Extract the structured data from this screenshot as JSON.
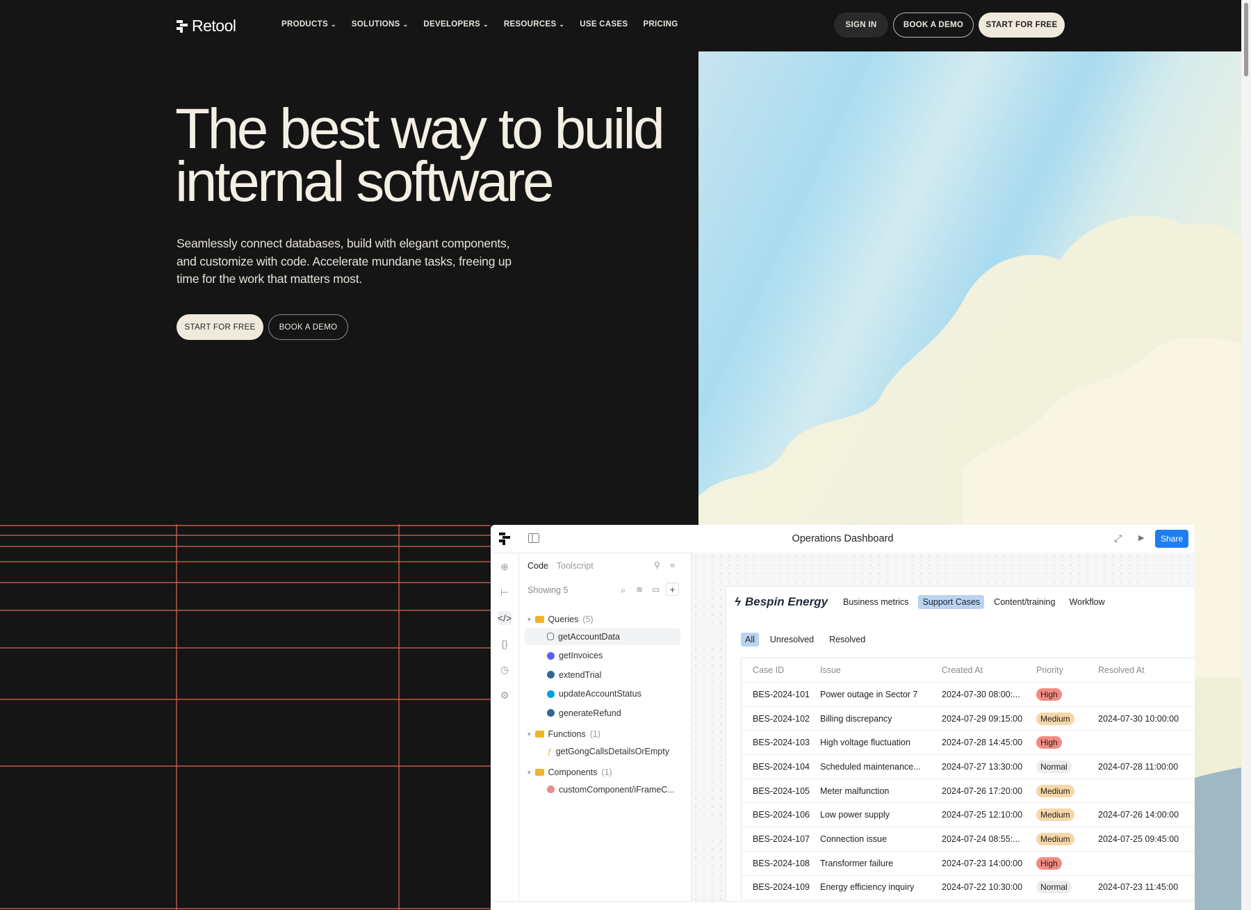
{
  "nav": {
    "brand": "Retool",
    "links": [
      {
        "label": "PRODUCTS",
        "chevron": true
      },
      {
        "label": "SOLUTIONS",
        "chevron": true
      },
      {
        "label": "DEVELOPERS",
        "chevron": true
      },
      {
        "label": "RESOURCES",
        "chevron": true
      },
      {
        "label": "USE CASES",
        "chevron": false
      },
      {
        "label": "PRICING",
        "chevron": false
      }
    ],
    "sign_in": "SIGN IN",
    "book_demo": "BOOK A DEMO",
    "start_free": "START FOR FREE"
  },
  "hero": {
    "title_line1": "The best way to build",
    "title_line2": "internal software",
    "subtitle": "Seamlessly connect databases, build with elegant components, and customize with code. Accelerate mundane tasks, freeing up time for the work that matters most.",
    "cta_start": "START FOR FREE",
    "cta_demo": "BOOK A DEMO"
  },
  "dashboard": {
    "title": "Operations Dashboard",
    "share": "Share",
    "panel": {
      "tab_code": "Code",
      "tab_toolscript": "Toolscript",
      "showing": "Showing 5",
      "folders": [
        {
          "name": "Queries",
          "count": "(5)",
          "items": [
            {
              "name": "getAccountData",
              "icon": "database-icon",
              "color": "#6b7280"
            },
            {
              "name": "getInvoices",
              "icon": "stripe-icon",
              "color": "#635bff"
            },
            {
              "name": "extendTrial",
              "icon": "postgres-icon",
              "color": "#336791"
            },
            {
              "name": "updateAccountStatus",
              "icon": "salesforce-icon",
              "color": "#00a1e0"
            },
            {
              "name": "generateRefund",
              "icon": "postgres-icon",
              "color": "#336791"
            }
          ]
        },
        {
          "name": "Functions",
          "count": "(1)",
          "items": [
            {
              "name": "getGongCallsDetailsOrEmpty",
              "icon": "function-icon",
              "color": "#f0b429"
            }
          ]
        },
        {
          "name": "Components",
          "count": "(1)",
          "items": [
            {
              "name": "customComponent/iFrameC...",
              "icon": "component-icon",
              "color": "#e88a8a"
            }
          ]
        }
      ]
    },
    "app": {
      "brand": "Bespin Energy",
      "tabs": [
        "Business metrics",
        "Support Cases",
        "Content/training",
        "Workflow"
      ],
      "active_tab": "Support Cases",
      "filters": [
        "All",
        "Unresolved",
        "Resolved"
      ],
      "active_filter": "All",
      "columns": [
        "Case ID",
        "Issue",
        "Created At",
        "Priority",
        "Resolved At"
      ],
      "rows": [
        {
          "id": "BES-2024-101",
          "issue": "Power outage in Sector 7",
          "created": "2024-07-30 08:00:...",
          "priority": "High",
          "resolved": ""
        },
        {
          "id": "BES-2024-102",
          "issue": "Billing discrepancy",
          "created": "2024-07-29 09:15:00",
          "priority": "Medium",
          "resolved": "2024-07-30 10:00:00"
        },
        {
          "id": "BES-2024-103",
          "issue": "High voltage fluctuation",
          "created": "2024-07-28 14:45:00",
          "priority": "High",
          "resolved": ""
        },
        {
          "id": "BES-2024-104",
          "issue": "Scheduled maintenance...",
          "created": "2024-07-27 13:30:00",
          "priority": "Normal",
          "resolved": "2024-07-28 11:00:00"
        },
        {
          "id": "BES-2024-105",
          "issue": "Meter malfunction",
          "created": "2024-07-26 17:20:00",
          "priority": "Medium",
          "resolved": ""
        },
        {
          "id": "BES-2024-106",
          "issue": "Low power supply",
          "created": "2024-07-25 12:10:00",
          "priority": "Medium",
          "resolved": "2024-07-26 14:00:00"
        },
        {
          "id": "BES-2024-107",
          "issue": "Connection issue",
          "created": "2024-07-24 08:55:...",
          "priority": "Medium",
          "resolved": "2024-07-25 09:45:00"
        },
        {
          "id": "BES-2024-108",
          "issue": "Transformer failure",
          "created": "2024-07-23 14:00:00",
          "priority": "High",
          "resolved": ""
        },
        {
          "id": "BES-2024-109",
          "issue": "Energy efficiency inquiry",
          "created": "2024-07-22 10:30:00",
          "priority": "Normal",
          "resolved": "2024-07-23 11:45:00"
        }
      ]
    }
  },
  "colors": {
    "background": "#151515",
    "accent_line": "#e0694e",
    "high": "#f28b82",
    "medium": "#f6d7a7",
    "normal": "#ececec",
    "share": "#1e7ef0",
    "active_tab": "#b9d3f2"
  }
}
